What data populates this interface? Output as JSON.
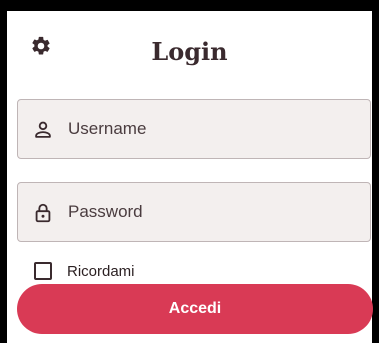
{
  "header": {
    "title": "Login",
    "settings_icon": "gear-icon"
  },
  "form": {
    "username": {
      "placeholder": "Username",
      "value": "",
      "icon": "user-icon"
    },
    "password": {
      "placeholder": "Password",
      "value": "",
      "icon": "lock-icon"
    },
    "remember": {
      "label": "Ricordami",
      "checked": false
    },
    "submit_label": "Accedi"
  },
  "colors": {
    "accent": "#d93a55",
    "field_bg": "#f3efee",
    "text": "#3a2a2e"
  }
}
